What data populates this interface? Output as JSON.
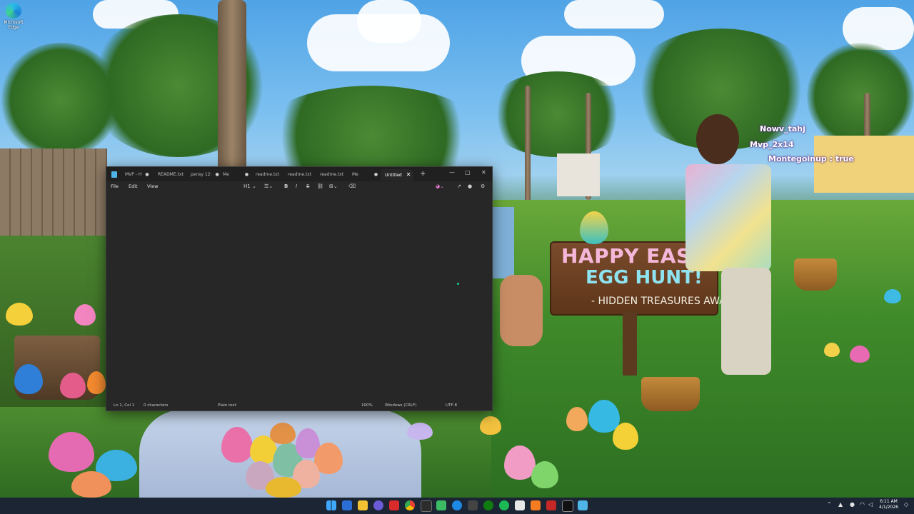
{
  "desktop": {
    "icon_label": "Microsoft Edge",
    "overlay_lines": [
      "Nowv_tahj",
      "Mvp_2x14",
      "Montegoinup : true"
    ]
  },
  "wallpaper": {
    "sign_line1": "HAPPY EASTER",
    "sign_line2": "EGG HUNT!",
    "sign_line3": "- HIDDEN TREASURES AWAIT"
  },
  "notepad": {
    "tabs": [
      {
        "label": "MVP - H",
        "modified": true
      },
      {
        "label": "README.txt",
        "modified": false
      },
      {
        "label": "pensy 12:",
        "modified": true
      },
      {
        "label": "Me",
        "modified": true
      },
      {
        "label": "readme.txt",
        "modified": false
      },
      {
        "label": "readme.txt",
        "modified": false
      },
      {
        "label": "readme.txt",
        "modified": false
      },
      {
        "label": "Me",
        "modified": true
      },
      {
        "label": "Untitled",
        "modified": false,
        "active": true
      }
    ],
    "menu": [
      "File",
      "Edit",
      "View"
    ],
    "heading_select": "H1",
    "status": {
      "position": "Ln 1, Col 1",
      "chars": "0 characters",
      "format": "Plain text",
      "zoom": "100%",
      "line_endings": "Windows (CRLF)",
      "encoding": "UTF-8"
    }
  },
  "taskbar": {
    "time": "6:11 AM",
    "date": "4/1/2026"
  },
  "colors": {
    "accent": "#17d38a",
    "window_bg": "#272727",
    "tabbar_bg": "#202020",
    "taskbar_bg": "#1c2533"
  }
}
